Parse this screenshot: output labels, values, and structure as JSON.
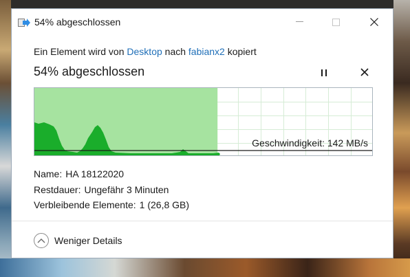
{
  "window": {
    "title": "54% abgeschlossen",
    "minimize_icon": "minimize-icon",
    "maximize_icon": "maximize-icon",
    "close_icon": "close-icon"
  },
  "copy_info": {
    "prefix": "Ein Element wird von ",
    "source": "Desktop",
    "middle": " nach ",
    "destination": "fabianx2",
    "suffix": " kopiert"
  },
  "progress": {
    "heading": "54% abgeschlossen",
    "percent": 54,
    "pause_icon": "pause-icon",
    "cancel_icon": "cancel-icon"
  },
  "graph": {
    "speed_label": "Geschwindigkeit: 142 MB/s",
    "fill_color": "#a6e3a0",
    "speed_color": "#1aad2b",
    "current_speed_mb_s": 142
  },
  "details": {
    "name_key": "Name:",
    "name_val": "HA 18122020",
    "remaining_key": "Restdauer:",
    "remaining_val": "Ungefähr 3 Minuten",
    "items_key": "Verbleibende Elemente:",
    "items_val": "1 (26,8 GB)"
  },
  "footer": {
    "toggle_label": "Weniger Details",
    "toggle_icon": "chevron-up-icon"
  }
}
